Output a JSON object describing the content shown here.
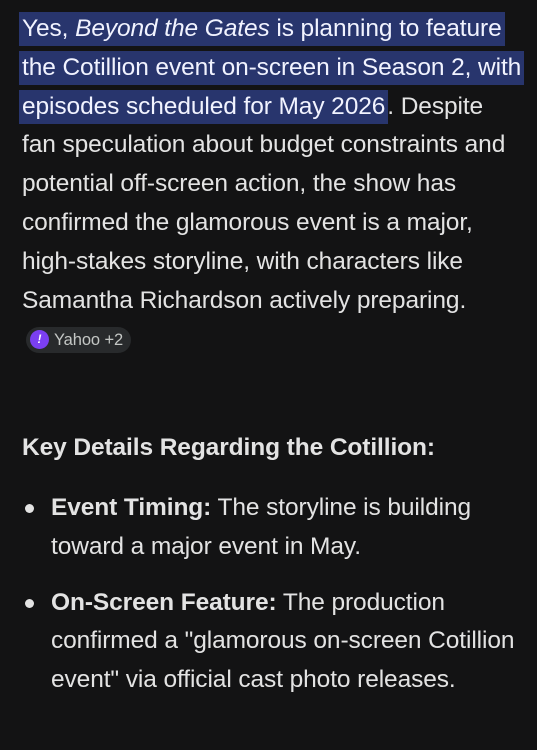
{
  "answer": {
    "highlight_prefix": "Yes, ",
    "show_title": "Beyond the Gates",
    "highlight_rest": " is planning to feature the Cotillion event on-screen in Season 2, with episodes scheduled for May 2026",
    "body_text": ". Despite fan speculation about budget constraints and potential off-screen action, the show has confirmed the glamorous event is a major, high-stakes storyline, with characters like Samantha Richardson actively preparing.",
    "source_chip": {
      "icon": "yahoo-icon",
      "icon_glyph": "!",
      "label": "Yahoo +2",
      "icon_color": "#7b3ff2"
    }
  },
  "section": {
    "heading": "Key Details Regarding the Cotillion:"
  },
  "details": [
    {
      "title": "Event Timing:",
      "text": " The storyline is building toward a major event in May."
    },
    {
      "title": "On-Screen Feature:",
      "text": " The production confirmed a \"glamorous on-screen Cotillion event\" via official cast photo releases."
    }
  ],
  "colors": {
    "background": "#131314",
    "text": "#e3e3e3",
    "highlight": "#28356d",
    "chip_background": "#282a2c"
  }
}
